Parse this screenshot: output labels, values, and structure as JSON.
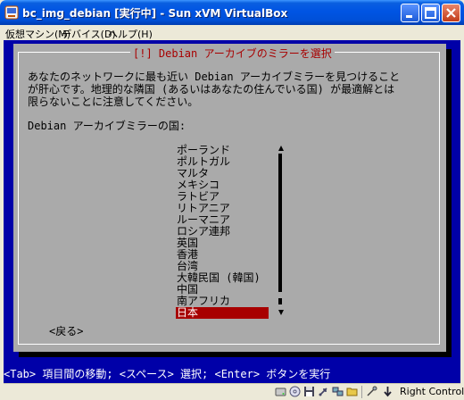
{
  "window": {
    "title": "bc_img_debian [実行中] - Sun xVM VirtualBox"
  },
  "menu": [
    {
      "label": "仮想マシン(M)"
    },
    {
      "label": "デバイス(D)"
    },
    {
      "label": "ヘルプ(H)"
    }
  ],
  "dialog": {
    "title": "[!] Debian アーカイブのミラーを選択",
    "description": [
      "あなたのネットワークに最も近い Debian アーカイブミラーを見つけること",
      "が肝心です。地理的な隣国 (あるいはあなたの住んでいる国) が最適解とは",
      "限らないことに注意してください。"
    ],
    "country_label": "Debian アーカイブミラーの国:",
    "countries": [
      "ポーランド",
      "ポルトガル",
      "マルタ",
      "メキシコ",
      "ラトビア",
      "リトアニア",
      "ルーマニア",
      "ロシア連邦",
      "英国",
      "香港",
      "台湾",
      "大韓民国 (韓国)",
      "中国",
      "南アフリカ",
      "日本"
    ],
    "selected_country": "日本",
    "back_button": "<戻る>"
  },
  "helpline": "<Tab> 項目間の移動; <スペース> 選択; <Enter> ボタンを実行",
  "statusbar": {
    "host_key": "Right Control",
    "icons": [
      "harddisk-icon",
      "cdrom-icon",
      "floppy-icon",
      "usb-icon",
      "network-icon",
      "shared-folder-icon",
      "mouse-integration-icon",
      "host-key-arrow-icon"
    ]
  },
  "colors": {
    "screen_bg": "#0000a8",
    "dialog_bg": "#aaaaaa",
    "selection": "#a80000",
    "dialog_title": "#a80000"
  }
}
